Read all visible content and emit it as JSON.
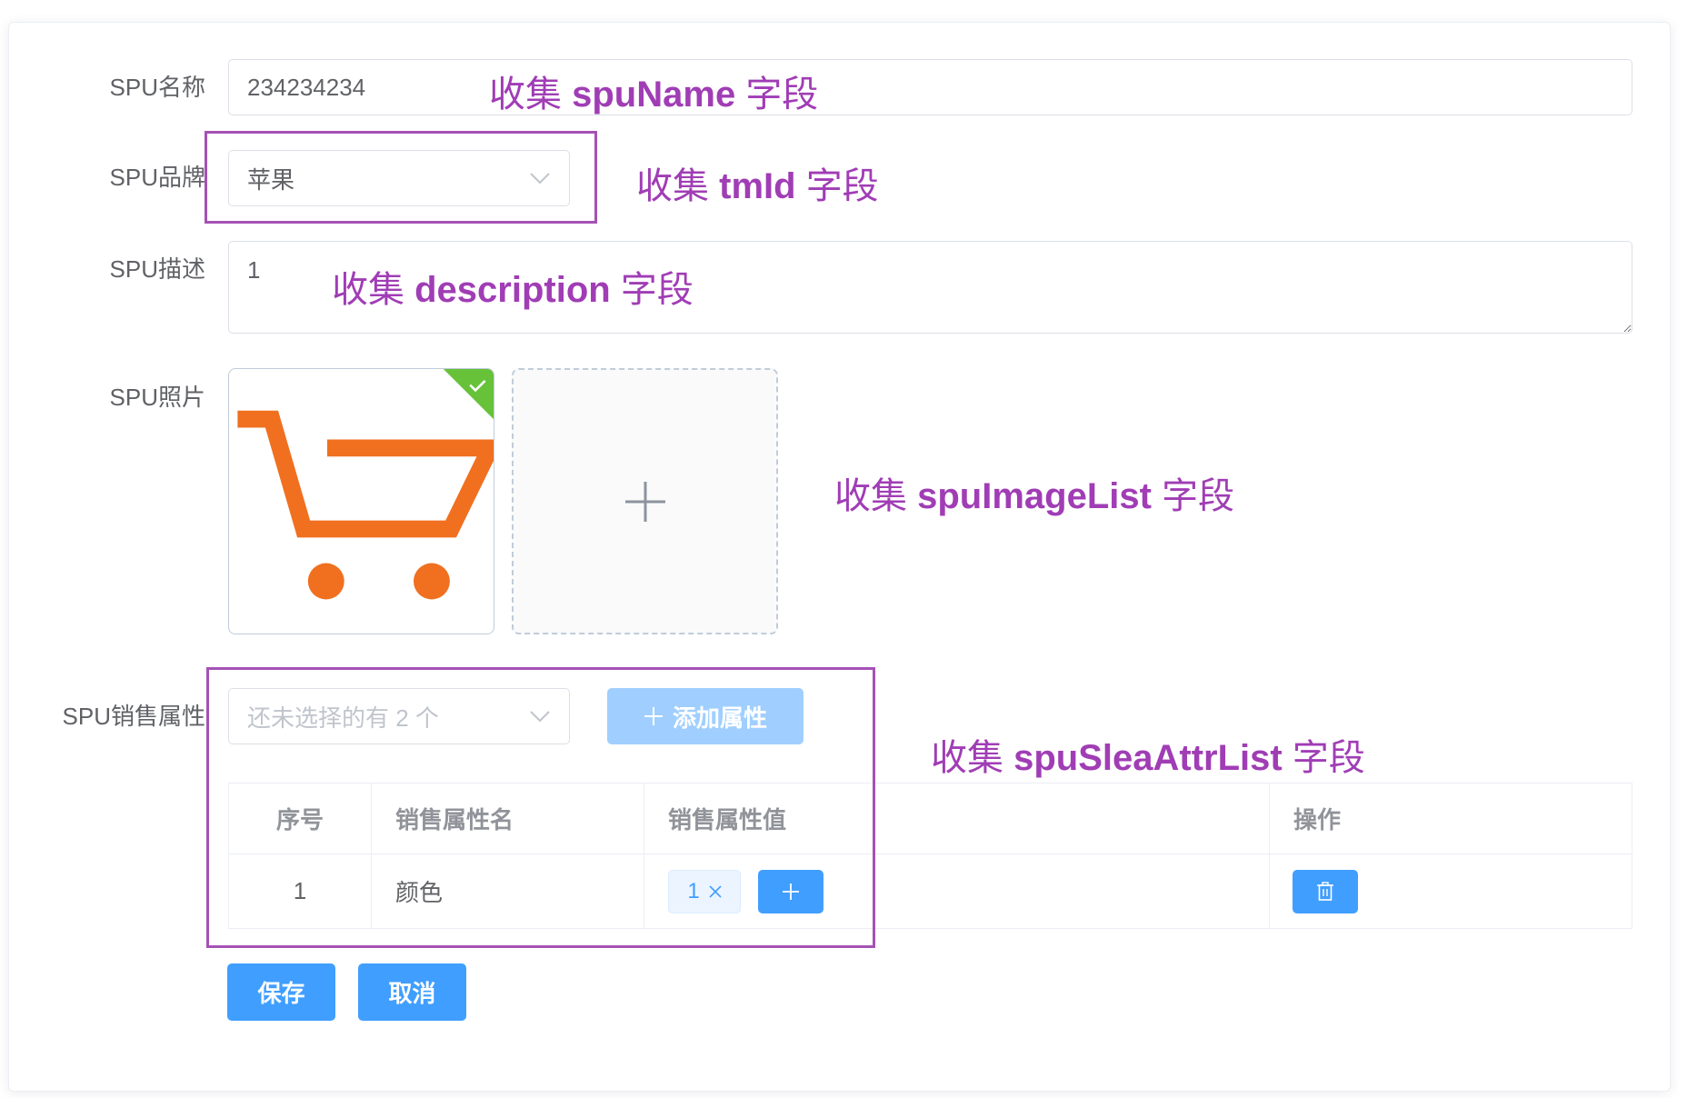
{
  "form": {
    "name": {
      "label": "SPU名称",
      "value": "234234234"
    },
    "brand": {
      "label": "SPU品牌",
      "value": "苹果"
    },
    "description": {
      "label": "SPU描述",
      "value": "1"
    },
    "images": {
      "label": "SPU照片",
      "items": [
        {
          "icon": "shopping-cart-image",
          "status": "success"
        }
      ],
      "upload_icon": "plus-icon"
    },
    "sale_attrs": {
      "label": "SPU销售属性",
      "select_placeholder": "还未选择的有 2 个",
      "add_button": "添加属性",
      "table": {
        "headers": [
          "序号",
          "销售属性名",
          "销售属性值",
          "操作"
        ],
        "rows": [
          {
            "index": "1",
            "name": "颜色",
            "values": [
              "1"
            ]
          }
        ]
      }
    },
    "actions": {
      "save": "保存",
      "cancel": "取消"
    }
  },
  "annotations": [
    {
      "prefix": "收集",
      "field": "spuName",
      "suffix": "字段"
    },
    {
      "prefix": "收集",
      "field": "tmId",
      "suffix": "字段"
    },
    {
      "prefix": "收集",
      "field": "description",
      "suffix": "字段"
    },
    {
      "prefix": "收集",
      "field": "spuImageList",
      "suffix": "字段"
    },
    {
      "prefix": "收集",
      "field": "spuSleaAttrList",
      "suffix": "字段"
    }
  ],
  "theme": {
    "primary": "#409eff",
    "primary_disabled": "#a0cfff",
    "annotation": "#a03db5",
    "annotation_box": "#a552b5",
    "cart": "#f07020",
    "success": "#67c23a"
  }
}
